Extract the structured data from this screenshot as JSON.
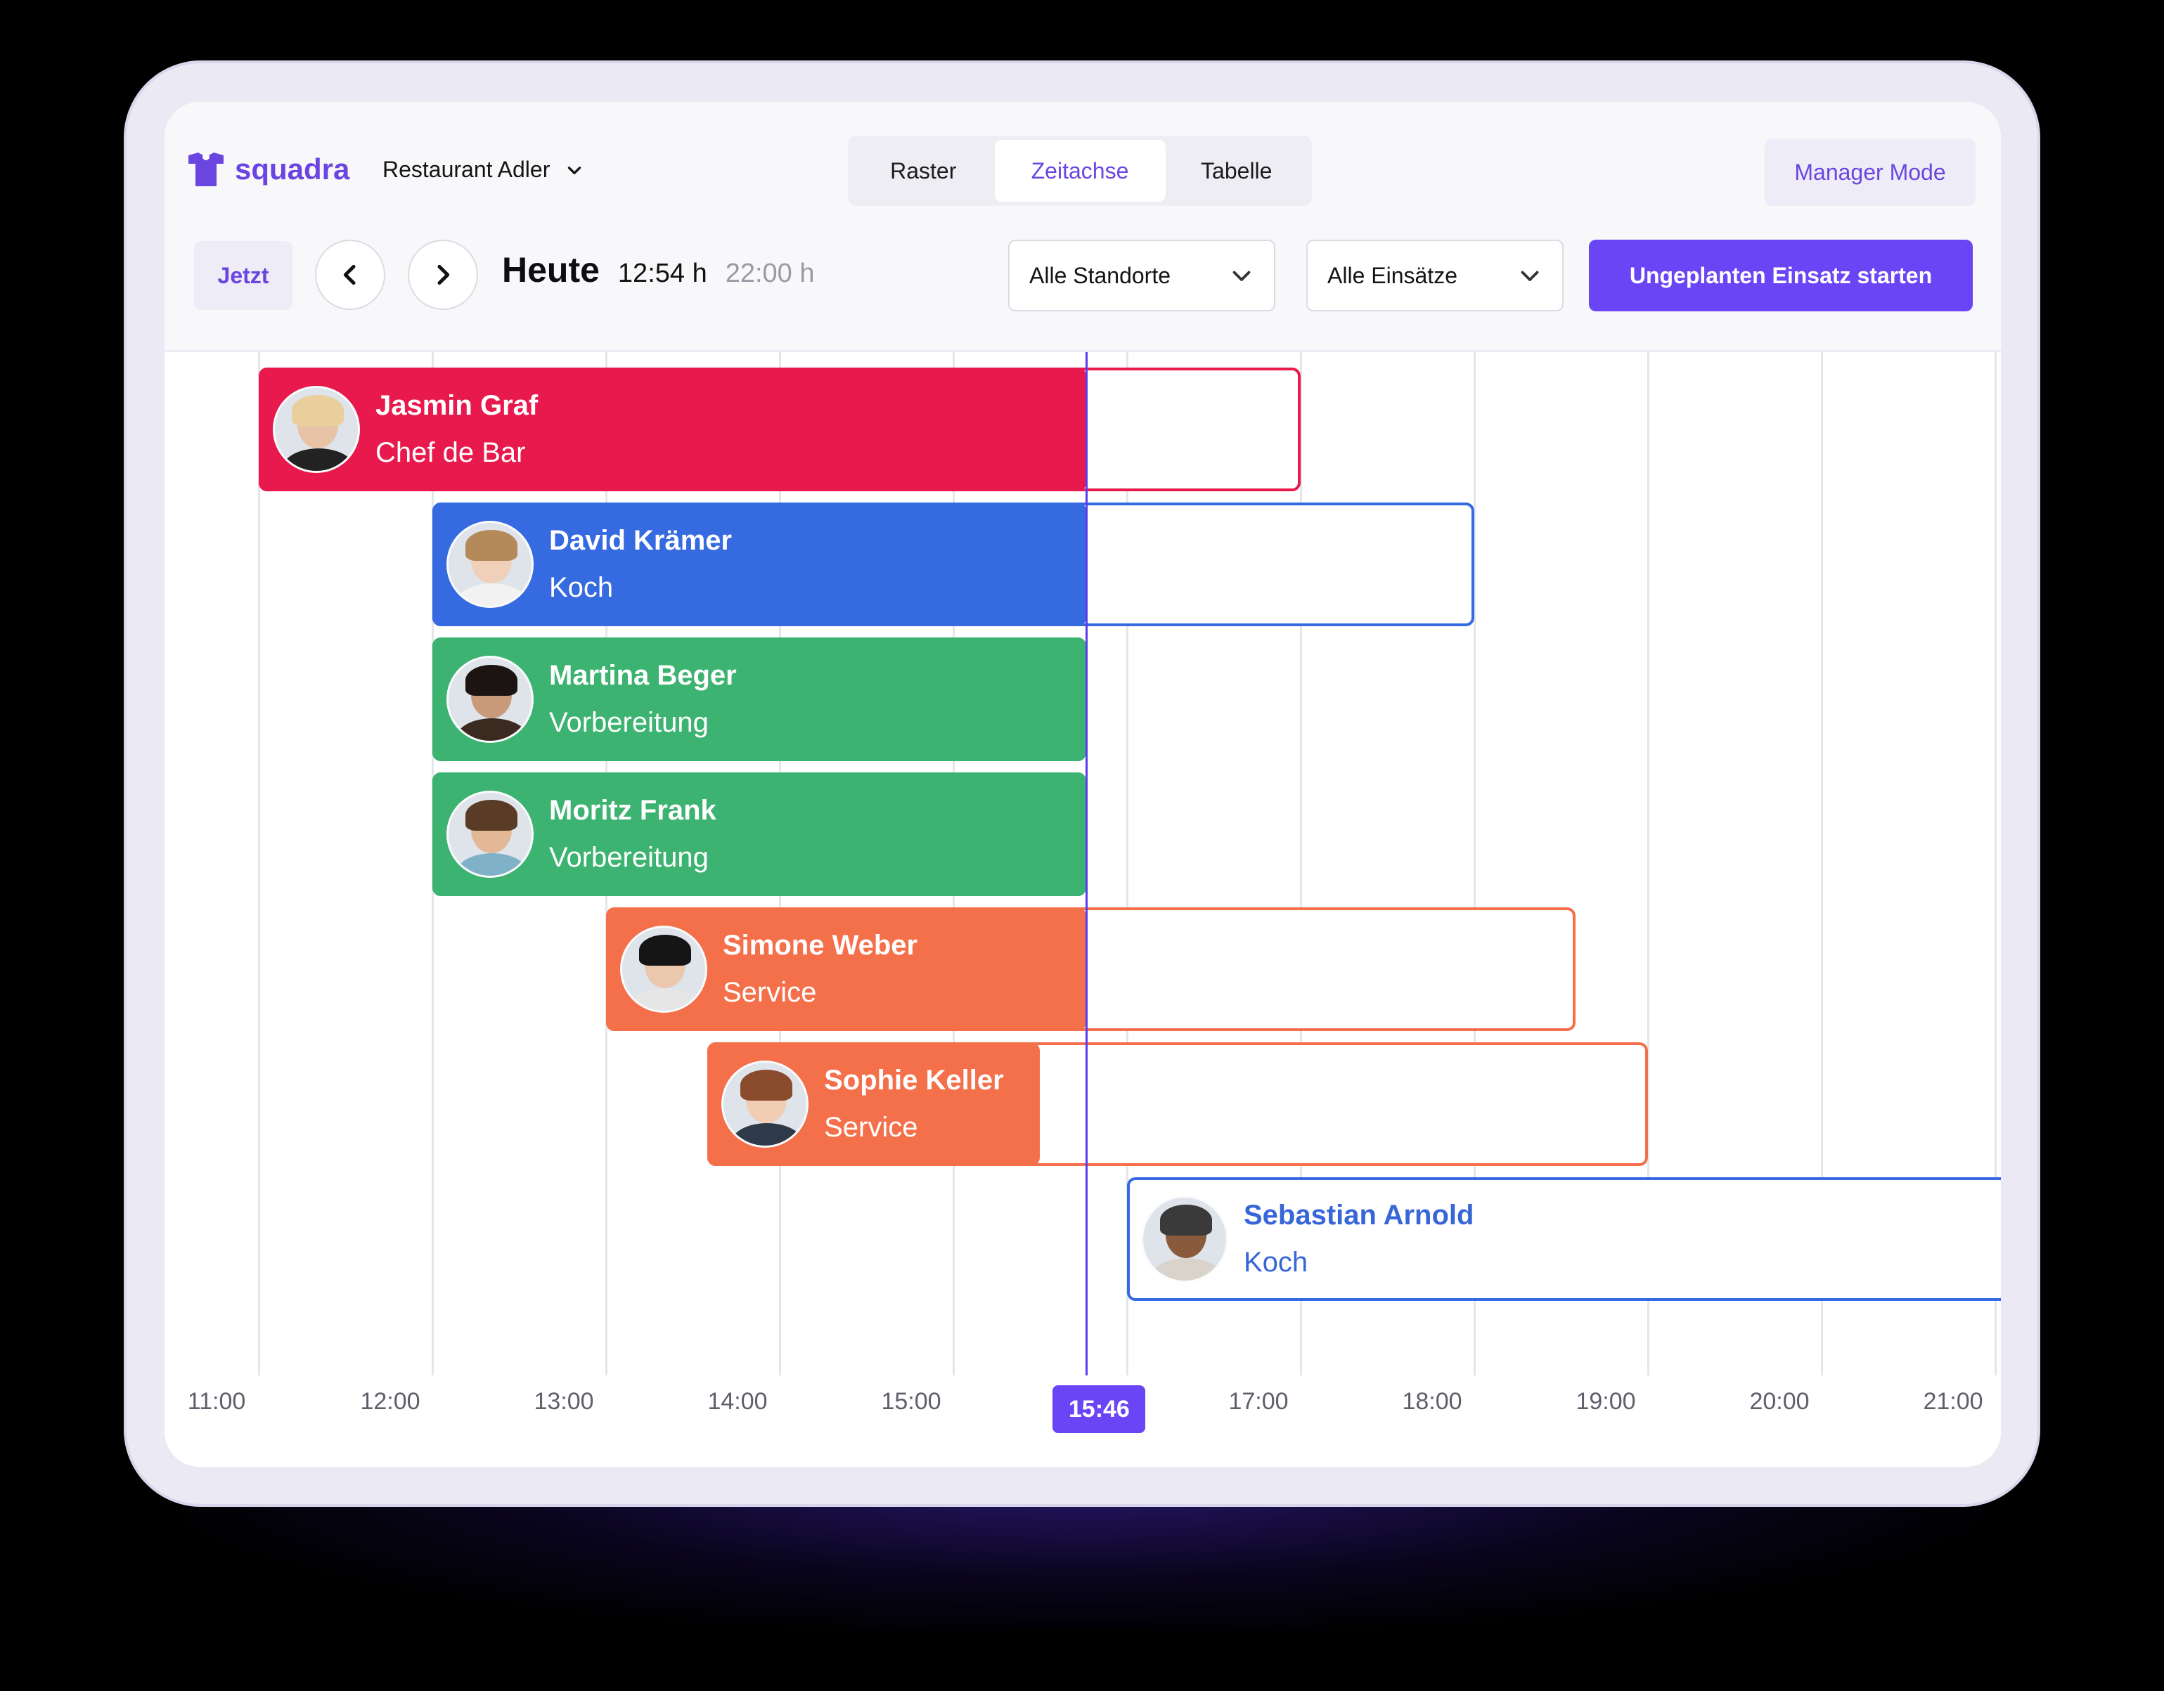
{
  "app": {
    "brand": "squadra",
    "location": "Restaurant Adler"
  },
  "tabs": [
    {
      "label": "Raster",
      "active": false
    },
    {
      "label": "Zeitachse",
      "active": true
    },
    {
      "label": "Tabelle",
      "active": false
    }
  ],
  "manager_mode": "Manager Mode",
  "toolbar": {
    "now_label": "Jetzt",
    "day_label": "Heute",
    "start_time": "12:54 h",
    "end_time": "22:00 h",
    "location_filter": "Alle Standorte",
    "shift_filter": "Alle Einsätze",
    "cta_label": "Ungeplanten Einsatz starten"
  },
  "timeline": {
    "ticks": [
      "11:00",
      "12:00",
      "13:00",
      "14:00",
      "15:00",
      "17:00",
      "18:00",
      "19:00",
      "20:00",
      "21:00"
    ],
    "now": "15:46"
  },
  "colors": {
    "accent": "#6a45f5",
    "red": "#e8194d",
    "blue": "#356ae0",
    "green": "#3db371",
    "orange": "#f4704b"
  },
  "shifts": [
    {
      "name": "Jasmin Graf",
      "role": "Chef de Bar",
      "color": "red",
      "start": "11:00",
      "end": "17:00",
      "elapsed_end": "15:46"
    },
    {
      "name": "David Krämer",
      "role": "Koch",
      "color": "blue",
      "start": "12:00",
      "end": "18:00",
      "elapsed_end": "15:46"
    },
    {
      "name": "Martina Beger",
      "role": "Vorbereitung",
      "color": "green",
      "start": "12:00",
      "end": "15:46",
      "elapsed_end": "15:46"
    },
    {
      "name": "Moritz Frank",
      "role": "Vorbereitung",
      "color": "green",
      "start": "12:00",
      "end": "15:46",
      "elapsed_end": "15:46"
    },
    {
      "name": "Simone Weber",
      "role": "Service",
      "color": "orange",
      "start": "13:00",
      "end": "18:35",
      "elapsed_end": "15:46"
    },
    {
      "name": "Sophie Keller",
      "role": "Service",
      "color": "orange",
      "start": "13:35",
      "end": "19:00",
      "elapsed_end": "15:30"
    },
    {
      "name": "Sebastian Arnold",
      "role": "Koch",
      "color": "blue",
      "start": "16:00",
      "end": "21:00",
      "planned": true
    }
  ]
}
